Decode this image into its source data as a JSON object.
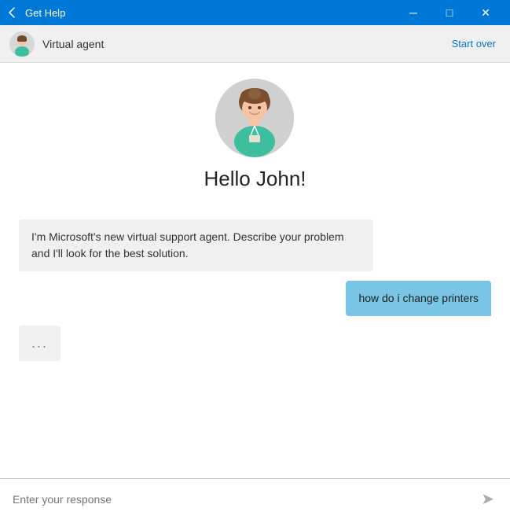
{
  "titleBar": {
    "title": "Get Help",
    "backIcon": "←",
    "minimizeIcon": "─",
    "maximizeIcon": "□",
    "closeIcon": "✕"
  },
  "header": {
    "agentName": "Virtual agent",
    "startOverLabel": "Start over"
  },
  "greeting": {
    "helloText": "Hello John!"
  },
  "messages": [
    {
      "type": "bot",
      "text": "I'm Microsoft's new virtual support agent. Describe your problem and I'll look for the best solution."
    },
    {
      "type": "user",
      "text": "how do i change printers"
    },
    {
      "type": "typing",
      "text": "..."
    }
  ],
  "inputBar": {
    "placeholder": "Enter your response",
    "sendIcon": "➤"
  }
}
